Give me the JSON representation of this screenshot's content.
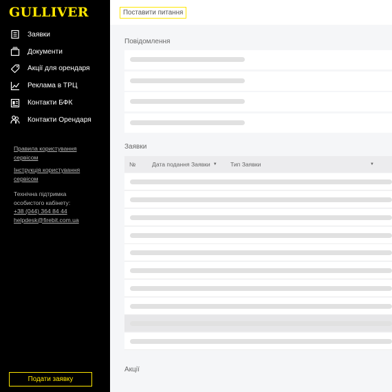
{
  "sidebar": {
    "logo": "GULLIVER",
    "nav": [
      {
        "label": "Заявки",
        "icon": "applications-icon"
      },
      {
        "label": "Документи",
        "icon": "documents-icon"
      },
      {
        "label": "Акції для орендаря",
        "icon": "tag-icon"
      },
      {
        "label": "Реклама в ТРЦ",
        "icon": "chart-icon"
      },
      {
        "label": "Контакти БФК",
        "icon": "contact-card-icon"
      },
      {
        "label": "Контакти Орендаря",
        "icon": "people-icon"
      }
    ],
    "links": {
      "rules_line1": "Правила користування",
      "rules_line2": "сервісом",
      "guide_line1": "Інструкція користування",
      "guide_line2": "сервісом"
    },
    "support": {
      "line1": "Технічна підтримка",
      "line2": "особистого кабінету:",
      "phone": "+38 (044) 364 84 44",
      "email": "helpdesk@firebit.com.ua"
    },
    "submit_label": "Подати заявку"
  },
  "topbar": {
    "ask_label": "Поставити питання"
  },
  "messages": {
    "title": "Повідомлення"
  },
  "requests": {
    "title": "Заявки",
    "columns": {
      "number": "№",
      "date": "Дата подання Заявки",
      "type": "Тип Заявки"
    }
  },
  "promotions": {
    "title": "Акції"
  }
}
